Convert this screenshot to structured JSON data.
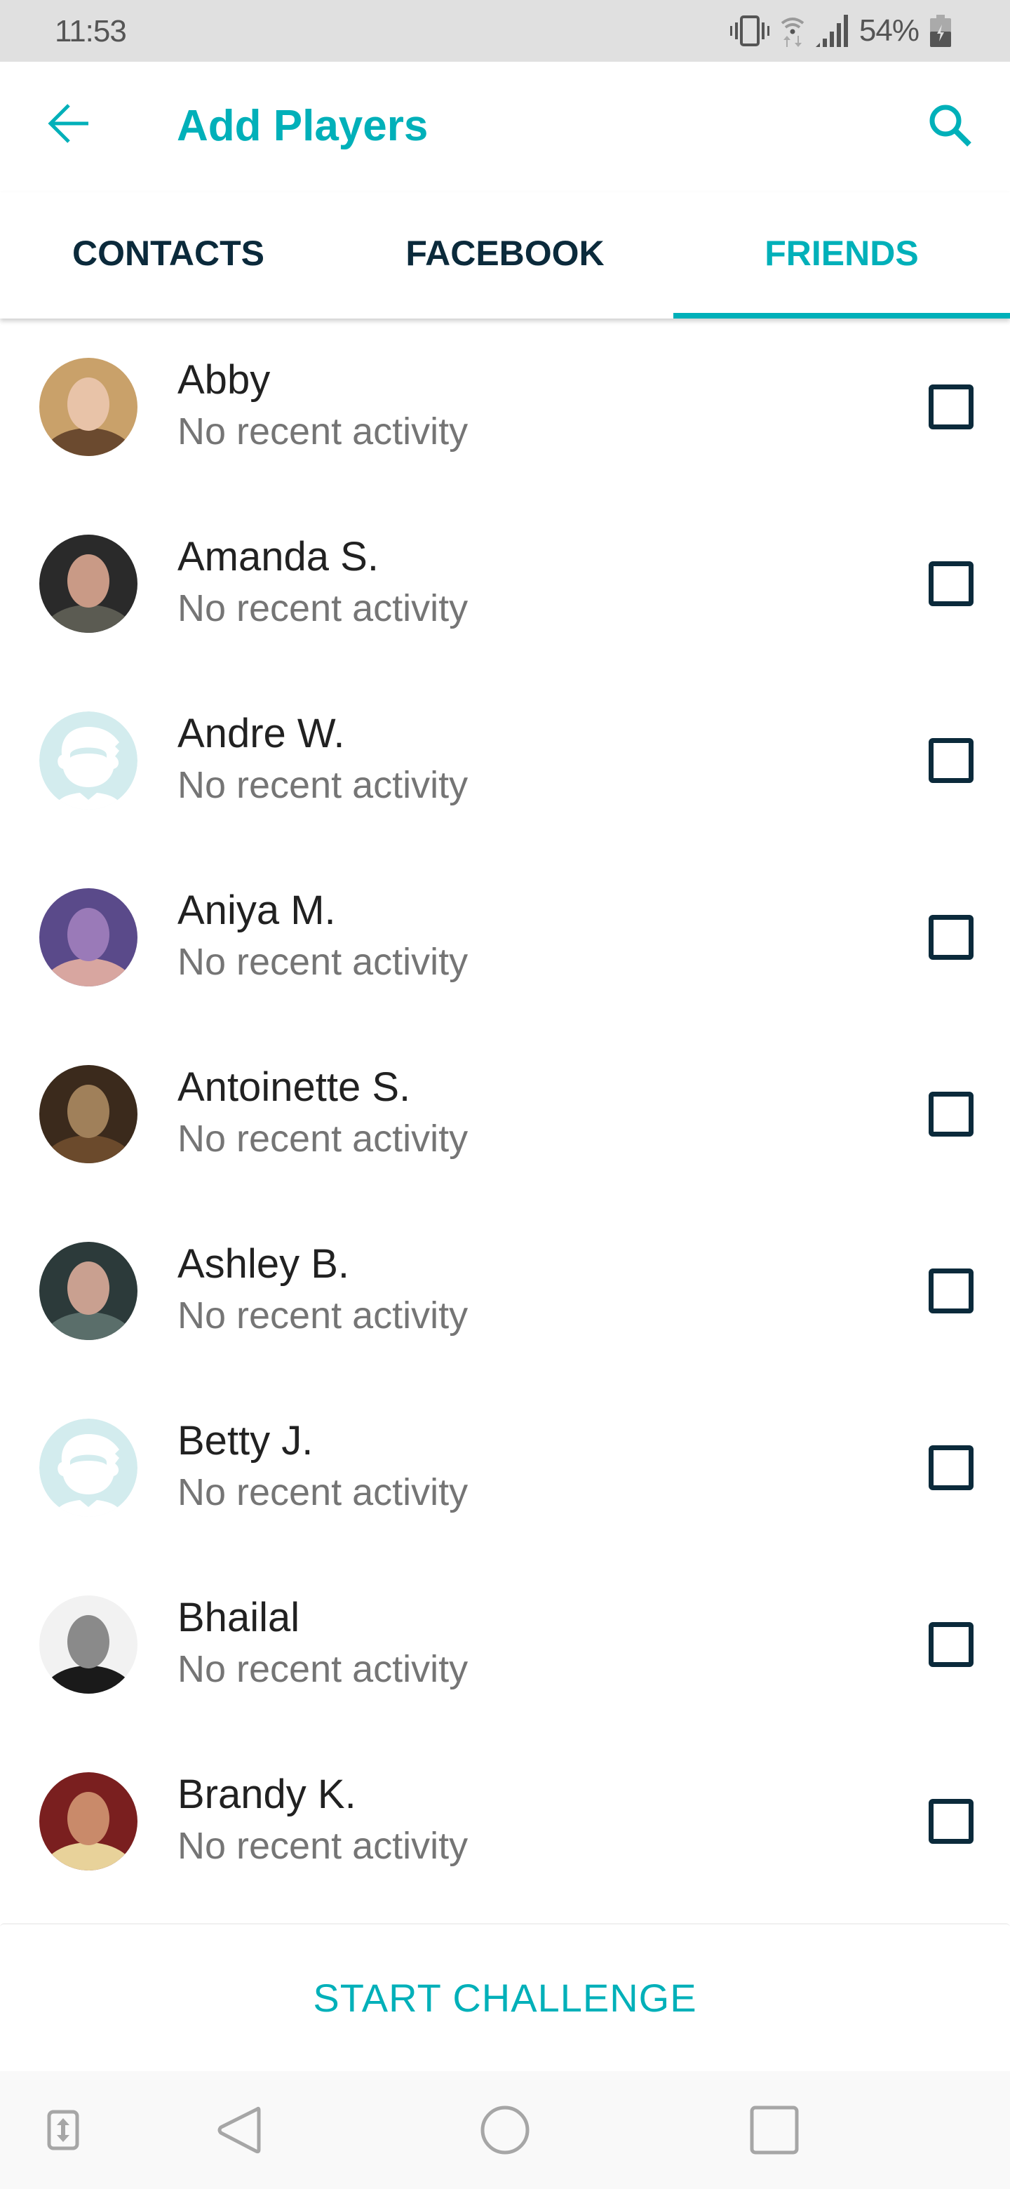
{
  "status_bar": {
    "time": "11:53",
    "battery_percent": "54%",
    "icons": [
      "vibrate-icon",
      "wifi-data-icon",
      "cell-signal-icon",
      "battery-charging-icon"
    ]
  },
  "app_bar": {
    "title": "Add Players",
    "back_icon": "arrow-left-icon",
    "search_icon": "search-icon"
  },
  "tabs": {
    "items": [
      {
        "label": "CONTACTS",
        "active": false
      },
      {
        "label": "FACEBOOK",
        "active": false
      },
      {
        "label": "FRIENDS",
        "active": true
      }
    ]
  },
  "friends": [
    {
      "name": "Abby",
      "status": "No recent activity",
      "avatar": "photo",
      "checked": false
    },
    {
      "name": "Amanda S.",
      "status": "No recent activity",
      "avatar": "photo",
      "checked": false
    },
    {
      "name": "Andre W.",
      "status": "No recent activity",
      "avatar": "default",
      "checked": false
    },
    {
      "name": "Aniya M.",
      "status": "No recent activity",
      "avatar": "photo",
      "checked": false
    },
    {
      "name": "Antoinette S.",
      "status": "No recent activity",
      "avatar": "photo",
      "checked": false
    },
    {
      "name": "Ashley B.",
      "status": "No recent activity",
      "avatar": "photo",
      "checked": false
    },
    {
      "name": "Betty J.",
      "status": "No recent activity",
      "avatar": "default",
      "checked": false
    },
    {
      "name": "Bhailal",
      "status": "No recent activity",
      "avatar": "photo",
      "checked": false
    },
    {
      "name": "Brandy K.",
      "status": "No recent activity",
      "avatar": "photo",
      "checked": false
    }
  ],
  "action": {
    "start_challenge_label": "START CHALLENGE"
  },
  "colors": {
    "accent": "#00b0b9",
    "tab_text": "#0b2a3b",
    "name_text": "#212121",
    "status_text": "#757575",
    "default_avatar_bg": "#d3ecee"
  }
}
